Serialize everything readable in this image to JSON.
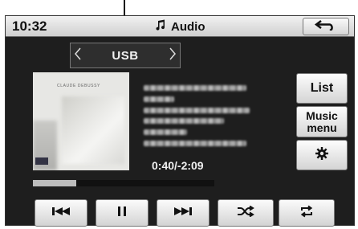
{
  "header": {
    "clock": "10:32",
    "title": "Audio",
    "title_icon": "music-note-icon",
    "back_icon": "back-arrow-icon"
  },
  "source": {
    "label": "USB",
    "prev_icon": "chevron-left-icon",
    "next_icon": "chevron-right-icon"
  },
  "album": {
    "cover_text": "CLAUDE DEBUSSY"
  },
  "track": {
    "time": "0:40/-2:09",
    "progress": 0.24
  },
  "side_menu": {
    "list": "List",
    "music_menu_line1": "Music",
    "music_menu_line2": "menu",
    "settings_icon": "gear-icon"
  },
  "controls": {
    "prev_icon": "skip-previous-icon",
    "pause_icon": "pause-icon",
    "next_icon": "skip-next-icon",
    "shuffle_icon": "shuffle-icon",
    "repeat_icon": "repeat-icon"
  },
  "colors": {
    "screen_bg": "#1e1e1e",
    "button_bg": "#e6e6e6",
    "text_light": "#f0f0f0"
  }
}
